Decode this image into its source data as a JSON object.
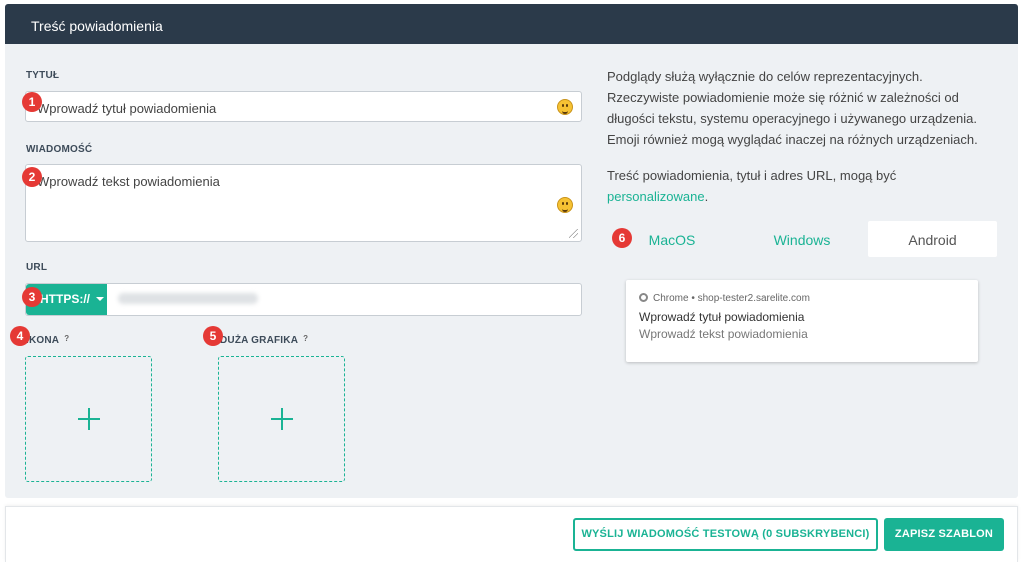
{
  "panel": {
    "title": "Treść powiadomienia"
  },
  "form": {
    "title_label": "TYTUŁ",
    "title_placeholder": "Wprowadź tytuł powiadomienia",
    "message_label": "WIADOMOŚĆ",
    "message_placeholder": "Wprowadź tekst powiadomienia",
    "url_label": "URL",
    "protocol": "HTTPS://",
    "icon_label": "IKONA",
    "image_label": "DUŻA GRAFIKA",
    "help_mark": "?"
  },
  "badges": [
    "1",
    "2",
    "3",
    "4",
    "5",
    "6"
  ],
  "info": {
    "line1": "Podglądy służą wyłącznie do celów reprezentacyjnych.",
    "line2": "Rzeczywiste powiadomienie może się różnić w zależności od",
    "line3": "długości tekstu, systemu operacyjnego i używanego urządzenia.",
    "line4": "Emoji również mogą wyglądać inaczej na różnych urządzeniach.",
    "line5": "Treść powiadomienia, tytuł i adres URL, mogą być",
    "link": "personalizowane",
    "period": "."
  },
  "tabs": [
    {
      "label": "MacOS",
      "active": false
    },
    {
      "label": "Windows",
      "active": false
    },
    {
      "label": "Android",
      "active": true
    }
  ],
  "preview": {
    "source": "Chrome • shop-tester2.sarelite.com",
    "title": "Wprowadź tytuł powiadomienia",
    "body": "Wprowadź tekst powiadomienia"
  },
  "footer": {
    "test_button": "WYŚLIJ WIADOMOŚĆ TESTOWĄ (0 SUBSKRYBENCI)",
    "save_button": "ZAPISZ SZABLON"
  },
  "colors": {
    "accent": "#1ab394",
    "header": "#2b3a4a",
    "badge": "#e53935",
    "panel": "#eef1f4"
  },
  "icons": {
    "emoji": "smiley-face-icon",
    "plus": "plus-icon",
    "caret": "caret-down-icon",
    "chrome": "chrome-icon"
  }
}
